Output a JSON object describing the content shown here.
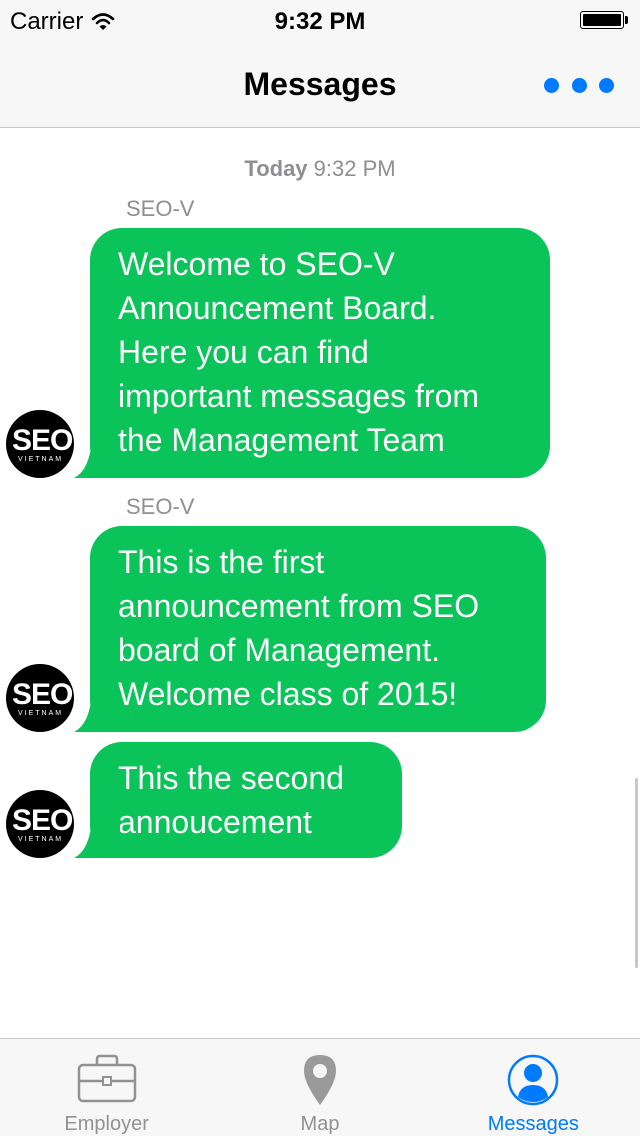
{
  "status_bar": {
    "carrier": "Carrier",
    "time": "9:32 PM",
    "icons": [
      "wifi-icon",
      "battery-icon"
    ]
  },
  "nav": {
    "title": "Messages",
    "more_icon": "more-dots-icon"
  },
  "conversation": {
    "timestamp_day": "Today",
    "timestamp_time": "9:32 PM",
    "messages": [
      {
        "sender": "SEO-V",
        "text": "Welcome to SEO-V\nAnnouncement Board.\nHere you can find\nimportant messages from\nthe Management Team",
        "avatar_text": "SEO",
        "avatar_sub": "VIETNAM"
      },
      {
        "sender": "SEO-V",
        "text": "This is the first\nannouncement from SEO\nboard of Management.\nWelcome class of 2015!",
        "avatar_text": "SEO",
        "avatar_sub": "VIETNAM"
      },
      {
        "sender": "",
        "text": "This the second\nannoucement",
        "avatar_text": "SEO",
        "avatar_sub": "VIETNAM"
      }
    ]
  },
  "tabs": [
    {
      "label": "Employer",
      "icon": "briefcase-icon",
      "active": false
    },
    {
      "label": "Map",
      "icon": "map-pin-icon",
      "active": false
    },
    {
      "label": "Messages",
      "icon": "user-circle-icon",
      "active": true
    }
  ],
  "colors": {
    "bubble": "#0ac45a",
    "accent": "#007aff",
    "inactive_tab": "#929292"
  }
}
